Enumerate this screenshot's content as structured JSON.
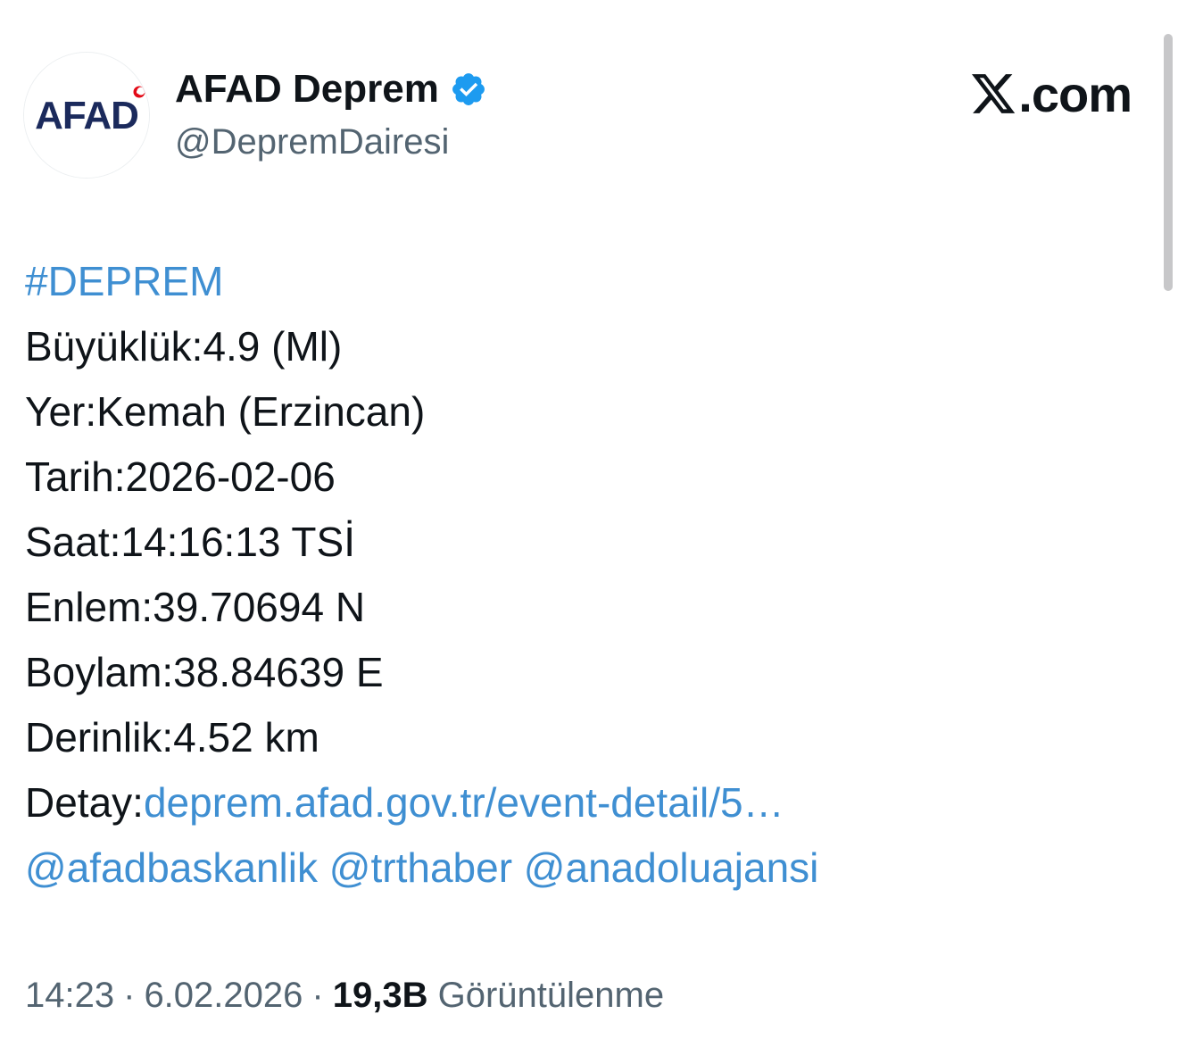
{
  "author": {
    "avatar_text": "AFAD",
    "display_name": "AFAD Deprem",
    "handle": "@DepremDairesi",
    "verified_icon": "verified-badge-icon"
  },
  "brand": {
    "logo_icon": "x-logo-icon",
    "suffix": ".com"
  },
  "tweet": {
    "hashtag": "#DEPREM",
    "magnitude_label": "Büyüklük:",
    "magnitude_value": "4.9 (Ml)",
    "location_label": "Yer:",
    "location_value": "Kemah (Erzincan)",
    "date_label": "Tarih:",
    "date_value": "2026-02-06",
    "time_label": "Saat:",
    "time_value": "14:16:13 TSİ",
    "latitude_label": "Enlem:",
    "latitude_value": "39.70694 N",
    "longitude_label": "Boylam:",
    "longitude_value": "38.84639 E",
    "depth_label": "Derinlik:",
    "depth_value": "4.52 km",
    "detail_label": "Detay:",
    "detail_link": "deprem.afad.gov.tr/event-detail/5…",
    "mentions": [
      "@afadbaskanlik",
      "@trthaber",
      "@anadoluajansi"
    ]
  },
  "meta": {
    "time": "14:23",
    "date": "6.02.2026",
    "separator": "·",
    "views_count": "19,3B",
    "views_label": "Görüntülenme"
  },
  "colors": {
    "link": "#3f8fd2",
    "verified": "#1d9bf0",
    "afad_navy": "#1b2a5c",
    "afad_red": "#e30a17",
    "secondary_text": "#536471"
  }
}
